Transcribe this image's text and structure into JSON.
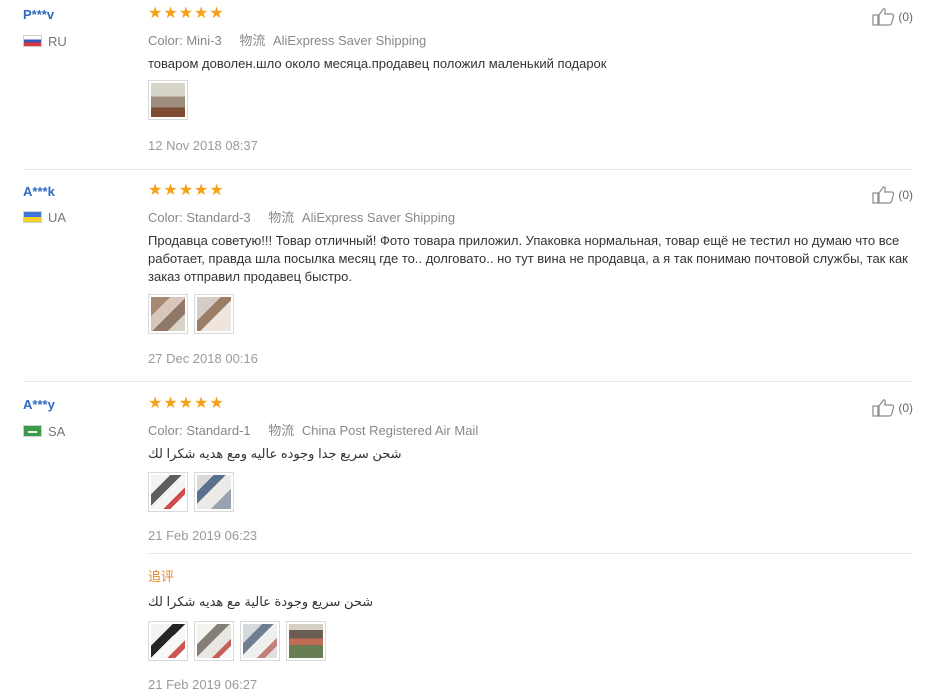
{
  "reviews": [
    {
      "user": {
        "name": "P***v",
        "country": "RU",
        "flag": "ru"
      },
      "stars": 5,
      "meta": {
        "color_label": "Color:",
        "color_value": "Mini-3",
        "shipping_label": "物流",
        "shipping_value": "AliExpress Saver Shipping"
      },
      "text": "товаром доволен.шло около месяца.продавец положил маленький подарок",
      "date": "12 Nov 2018 08:37",
      "helpful": "(0)"
    },
    {
      "user": {
        "name": "A***k",
        "country": "UA",
        "flag": "ua"
      },
      "stars": 5,
      "meta": {
        "color_label": "Color:",
        "color_value": "Standard-3",
        "shipping_label": "物流",
        "shipping_value": "AliExpress Saver Shipping"
      },
      "text": "Продавца советую!!! Товар отличный! Фото товара приложил. Упаковка нормальная, товар ещё не тестил но думаю что все работает, правда шла посылка месяц где то.. долговато.. но тут вина не продавца, а я так понимаю почтовой службы, так как заказ отправил продавец быстро.",
      "date": "27 Dec 2018 00:16",
      "helpful": "(0)"
    },
    {
      "user": {
        "name": "A***y",
        "country": "SA",
        "flag": "sa"
      },
      "stars": 5,
      "meta": {
        "color_label": "Color:",
        "color_value": "Standard-1",
        "shipping_label": "物流",
        "shipping_value": "China Post Registered Air Mail"
      },
      "text": "شحن سريع جدا وجوده عاليه ومع هديه شكرا لك",
      "date": "21 Feb 2019 06:23",
      "helpful": "(0)",
      "follow_up": {
        "label": "追评",
        "text": "شحن سريع وجودة عالية مع هديه شكرا لك",
        "date": "21 Feb 2019 06:27"
      }
    }
  ],
  "colors": {
    "username": "#2f6bbf",
    "star": "#f6a11a",
    "follow_up_label": "#e28b2a",
    "divider": "#e8e8e8"
  },
  "icons": {
    "helpful": "thumbs-up-icon",
    "flag": "country-flag-icon",
    "star": "star-icon"
  }
}
